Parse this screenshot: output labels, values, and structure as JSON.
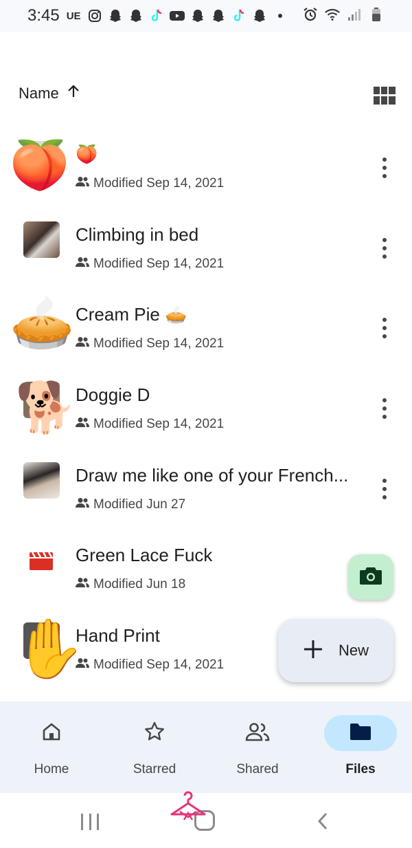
{
  "status_bar": {
    "time": "3:45",
    "carrier": "UE"
  },
  "sort": {
    "label": "Name"
  },
  "files": [
    {
      "title": "🍑",
      "modified": "Modified Sep 14, 2021",
      "thumb": "peach-emoji"
    },
    {
      "title": "Climbing in bed",
      "modified": "Modified Sep 14, 2021",
      "thumb": "photo"
    },
    {
      "title": "Cream Pie 🥧",
      "modified": "Modified Sep 14, 2021",
      "thumb": "pie-emoji"
    },
    {
      "title": "Doggie D",
      "modified": "Modified Sep 14, 2021",
      "thumb": "dog-emoji"
    },
    {
      "title": "Draw me like one of your French...",
      "modified": "Modified Jun 27",
      "thumb": "photo"
    },
    {
      "title": "Green Lace Fuck",
      "modified": "Modified Jun 18",
      "thumb": "video-icon"
    },
    {
      "title": "Hand Print",
      "modified": "Modified Sep 14, 2021",
      "thumb": "hand-emoji"
    }
  ],
  "thumb_emojis": {
    "peach": "🍑",
    "pie": "🥧",
    "dog": "🐕",
    "hand": "✋"
  },
  "fab": {
    "new_label": "New"
  },
  "bottom_nav": [
    {
      "label": "Home",
      "icon": "home-icon",
      "active": false
    },
    {
      "label": "Starred",
      "icon": "star-icon",
      "active": false
    },
    {
      "label": "Shared",
      "icon": "people-icon",
      "active": false
    },
    {
      "label": "Files",
      "icon": "folder-icon",
      "active": true
    }
  ],
  "colors": {
    "accent_pill": "#c2e7ff",
    "camera_fab": "#c4eed0",
    "video_icon": "#d93025",
    "nav_background": "#eef2f9"
  }
}
